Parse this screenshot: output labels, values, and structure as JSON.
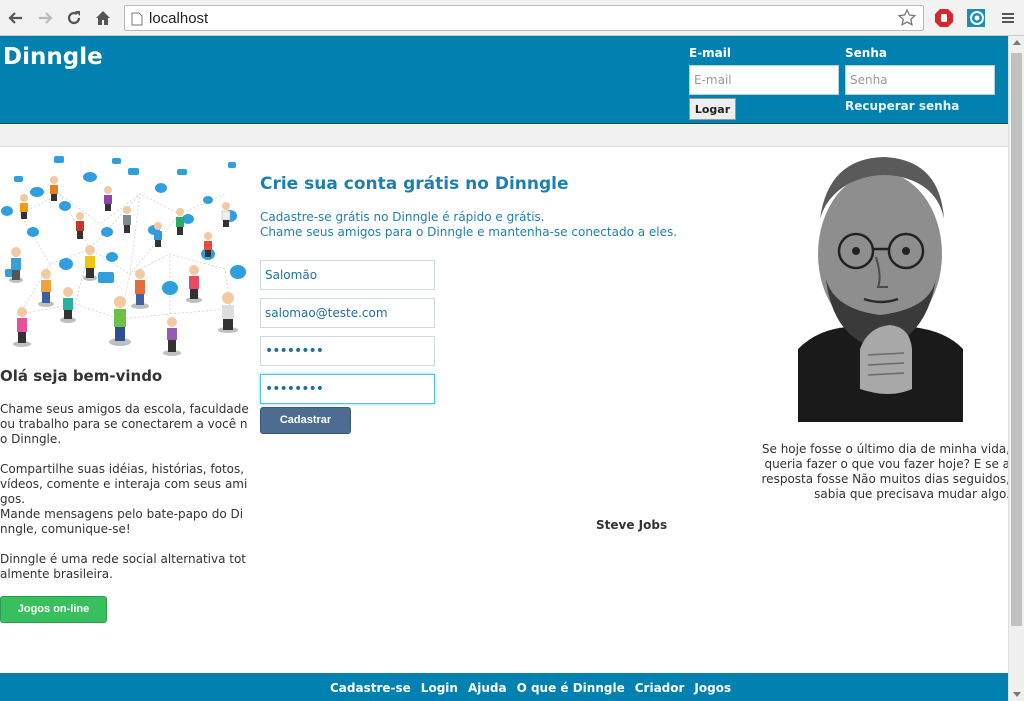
{
  "browser": {
    "url": "localhost",
    "icons": [
      "back-icon",
      "forward-icon",
      "reload-icon",
      "home-icon",
      "page-icon",
      "bookmark-star-icon",
      "adblock-icon",
      "extension-icon",
      "menu-icon"
    ]
  },
  "header": {
    "logo": "Dinngle",
    "email_label": "E-mail",
    "email_placeholder": "E-mail",
    "password_label": "Senha",
    "password_placeholder": "Senha",
    "login_button": "Logar",
    "recover_link": "Recuperar senha"
  },
  "left": {
    "welcome_title": "Olá seja bem-vindo",
    "paragraphs": [
      "Chame seus amigos da escola, faculdade ou trabalho para se conectarem a você no Dinngle.",
      "Compartilhe suas idéias, histórias, fotos, vídeos, comente e interaja com seus amigos.",
      "Mande mensagens pelo bate-papo do Dinngle, comunique-se!",
      "Dinngle é uma rede social alternativa totalmente brasileira."
    ],
    "games_button": "Jogos on-line"
  },
  "signup": {
    "title": "Crie sua conta grátis no Dinngle",
    "description_line1": "Cadastre-se grátis no Dinngle é rápido e grátis.",
    "description_line2": "Chame seus amigos para o Dinngle e mantenha-se conectado a eles.",
    "name_value": "Salomão",
    "email_value": "salomao@teste.com",
    "password_value": "••••••••",
    "confirm_password_value": "••••••••",
    "submit_button": "Cadastrar"
  },
  "quote": {
    "text": "Se hoje fosse o último dia de minha vida, queria fazer o que vou fazer hoje? E se a resposta fosse Não muitos dias seguidos, sabia que precisava mudar algo.",
    "author": "Steve Jobs"
  },
  "footer": {
    "links": [
      "Cadastre-se",
      "Login",
      "Ajuda",
      "O que é Dinngle",
      "Criador",
      "Jogos"
    ]
  },
  "colors": {
    "brand_blue": "#0081b0",
    "link_blue": "#1f7fb0",
    "submit_blue": "#4d6c91",
    "games_green": "#39c05e"
  }
}
